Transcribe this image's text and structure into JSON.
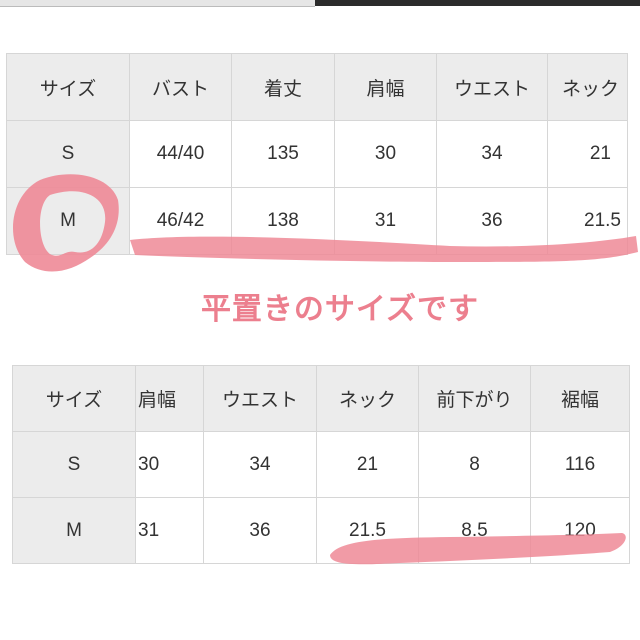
{
  "table_top": {
    "headers": [
      "サイズ",
      "バスト",
      "着丈",
      "肩幅",
      "ウエスト",
      "ネック"
    ],
    "rows": [
      [
        "S",
        "44/40",
        "135",
        "30",
        "34",
        "21"
      ],
      [
        "M",
        "46/42",
        "138",
        "31",
        "36",
        "21.5"
      ]
    ]
  },
  "caption": "平置きのサイズです",
  "table_bottom": {
    "headers": [
      "サイズ",
      "肩幅",
      "ウエスト",
      "ネック",
      "前下がり",
      "裾幅"
    ],
    "rows": [
      [
        "S",
        "30",
        "34",
        "21",
        "8",
        "116"
      ],
      [
        "M",
        "31",
        "36",
        "21.5",
        "8.5",
        "120"
      ]
    ]
  },
  "colors": {
    "highlight": "#ee8a97",
    "header_bg": "#ececec"
  }
}
